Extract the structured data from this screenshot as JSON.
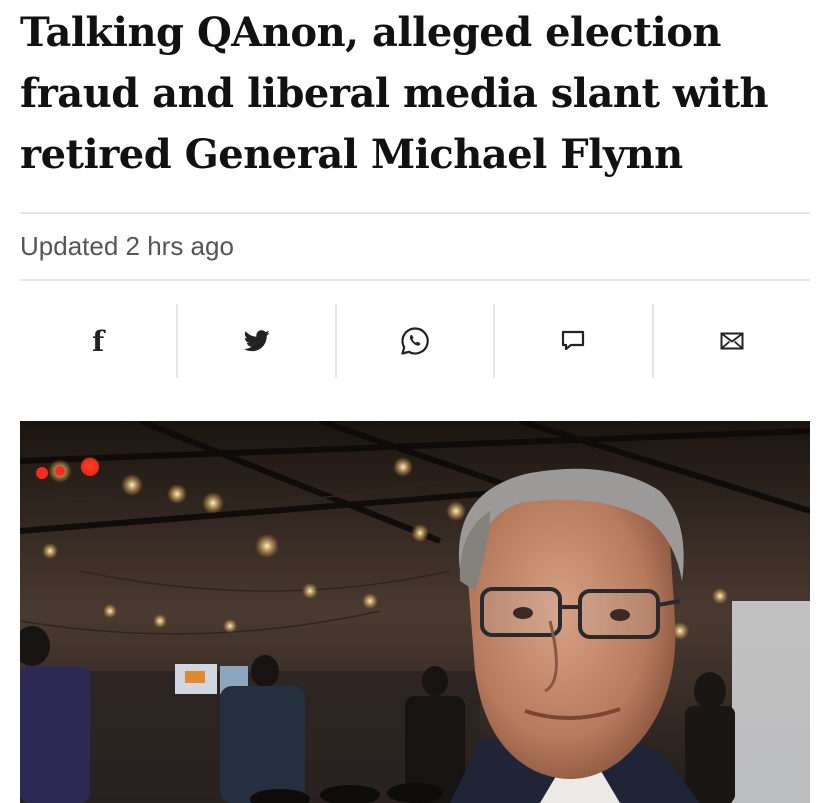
{
  "article": {
    "headline": "Talking QAnon, alleged election fraud and liberal media slant with retired General Michael Flynn",
    "updated": "Updated 2 hrs ago"
  },
  "share_bar": {
    "items": [
      {
        "name": "facebook",
        "icon": "facebook-icon"
      },
      {
        "name": "twitter",
        "icon": "twitter-icon"
      },
      {
        "name": "whatsapp",
        "icon": "whatsapp-icon"
      },
      {
        "name": "comment",
        "icon": "comment-icon"
      },
      {
        "name": "email",
        "icon": "email-icon"
      }
    ],
    "facebook_glyph": "f"
  },
  "photo": {
    "subject": "man with glasses in a dim event hall"
  },
  "colors": {
    "text": "#111111",
    "meta": "#555555",
    "divider": "#e6e6e6",
    "icon": "#222222"
  }
}
